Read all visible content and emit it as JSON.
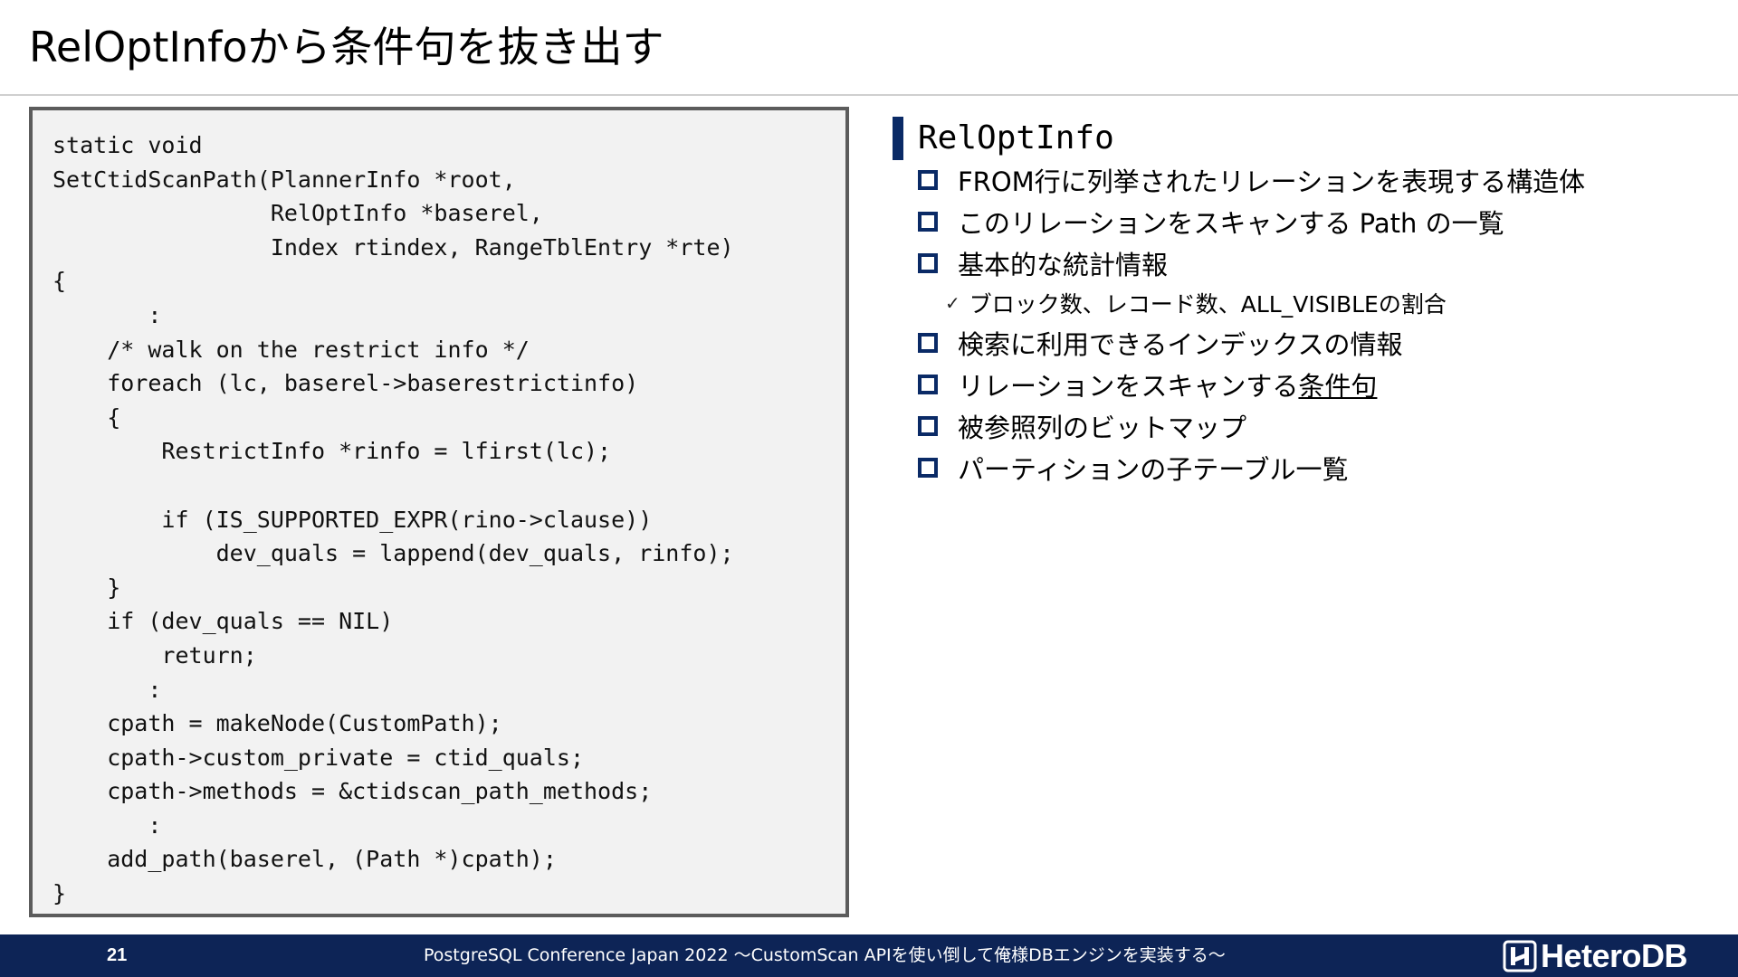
{
  "slide": {
    "title": "RelOptInfoから条件句を抜き出す"
  },
  "code": {
    "lines": [
      "static void",
      "SetCtidScanPath(PlannerInfo *root,",
      "                RelOptInfo *baserel,",
      "                Index rtindex, RangeTblEntry *rte)",
      "{",
      "       :",
      "    /* walk on the restrict info */",
      "    foreach (lc, baserel->baserestrictinfo)",
      "    {",
      "        RestrictInfo *rinfo = lfirst(lc);",
      "",
      "        if (IS_SUPPORTED_EXPR(rino->clause))",
      "            dev_quals = lappend(dev_quals, rinfo);",
      "    }",
      "    if (dev_quals == NIL)",
      "        return;",
      "       :",
      "    cpath = makeNode(CustomPath);",
      "    cpath->custom_private = ctid_quals;",
      "    cpath->methods = &ctidscan_path_methods;",
      "       :",
      "    add_path(baserel, (Path *)cpath);",
      "}"
    ]
  },
  "panel": {
    "heading": "RelOptInfo",
    "items": [
      "FROM行に列挙されたリレーションを表現する構造体",
      "このリレーションをスキャンする Path の一覧",
      "基本的な統計情報",
      "検索に利用できるインデックスの情報",
      "リレーションをスキャンする",
      "被参照列のビットマップ",
      "パーティションの子テーブル一覧"
    ],
    "item5_underlined": "条件句",
    "sub_item": "ブロック数、レコード数、ALL_VISIBLEの割合",
    "check_glyph": "✓"
  },
  "footer": {
    "page_number": "21",
    "text": "PostgreSQL Conference Japan 2022 〜CustomScan APIを使い倒して俺様DBエンジンを実装する〜",
    "logo_text": "HeteroDB",
    "logo_icon": "heterodb-logo-icon"
  },
  "colors": {
    "accent": "#0a2a66",
    "footer_bg": "#0d2456",
    "code_bg": "#f2f2f2",
    "code_border": "#5c5c5c"
  }
}
